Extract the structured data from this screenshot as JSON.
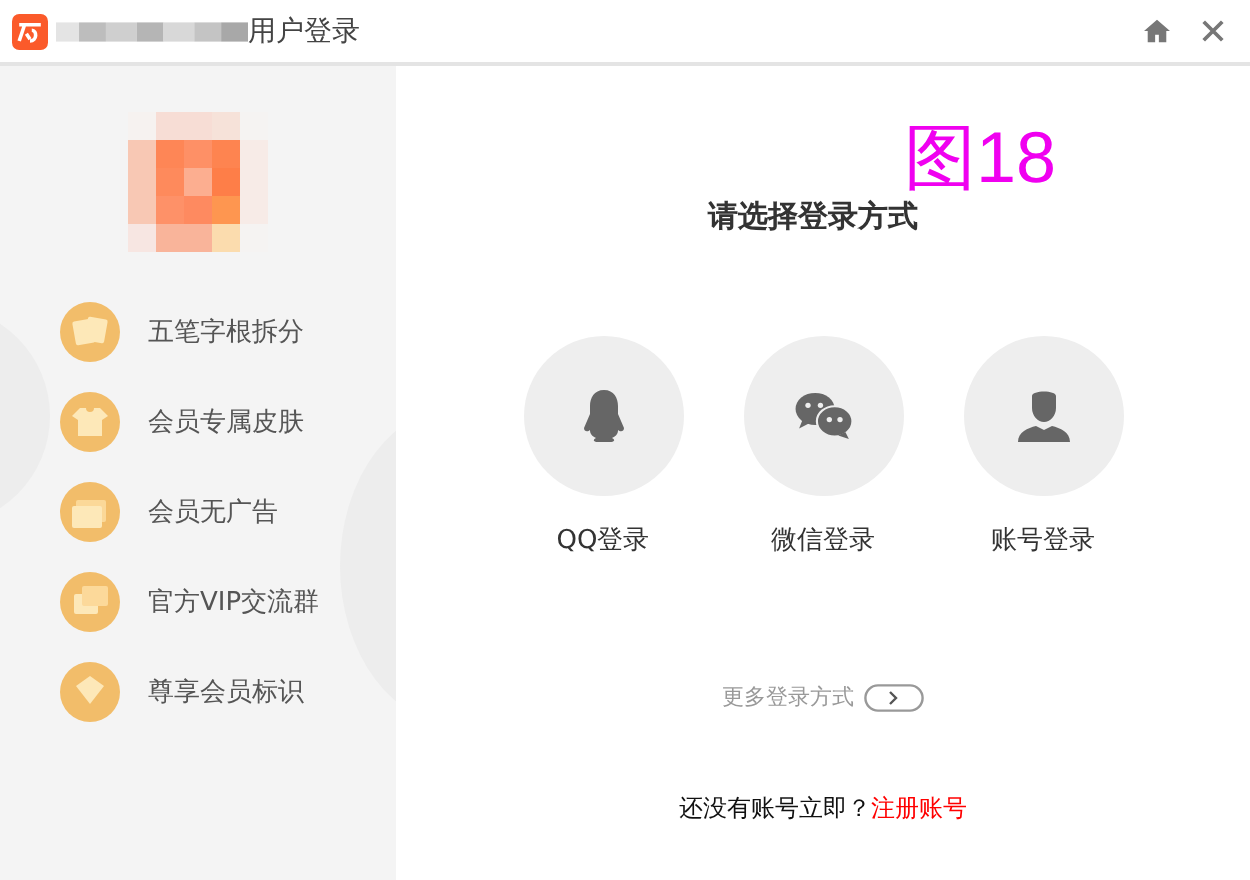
{
  "window": {
    "title": "用户登录"
  },
  "sidebar": {
    "features": [
      {
        "label": "五笔字根拆分",
        "kind": "cards"
      },
      {
        "label": "会员专属皮肤",
        "kind": "shirt"
      },
      {
        "label": "会员无广告",
        "kind": "ad"
      },
      {
        "label": "官方VIP交流群",
        "kind": "chat"
      },
      {
        "label": "尊享会员标识",
        "kind": "badge"
      }
    ]
  },
  "annotation": "图18",
  "heading": "请选择登录方式",
  "methods": [
    {
      "label": "QQ登录",
      "kind": "qq"
    },
    {
      "label": "微信登录",
      "kind": "wechat"
    },
    {
      "label": "账号登录",
      "kind": "account"
    }
  ],
  "more": "更多登录方式",
  "footer": {
    "prompt": "还没有账号立即？",
    "link": "注册账号"
  }
}
